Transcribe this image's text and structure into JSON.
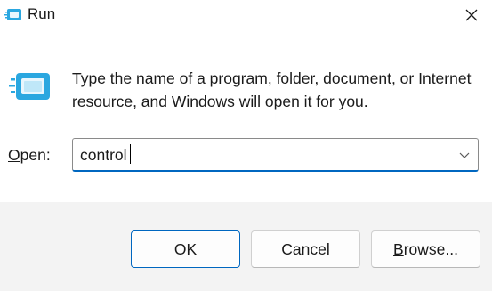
{
  "window": {
    "title": "Run",
    "icons": {
      "app": "run-icon",
      "close": "close-icon",
      "dropdown": "chevron-down-icon"
    }
  },
  "message": "Type the name of a program, folder, document, or Internet resource, and Windows will open it for you.",
  "open_field": {
    "label_mnemonic": "O",
    "label_rest": "pen:",
    "value": "control"
  },
  "buttons": {
    "ok": "OK",
    "cancel": "Cancel",
    "browse_mnemonic": "B",
    "browse_rest": "rowse..."
  },
  "colors": {
    "accent": "#0067c0",
    "footer_bg": "#f3f3f3",
    "icon_blue": "#2aa7e0"
  }
}
